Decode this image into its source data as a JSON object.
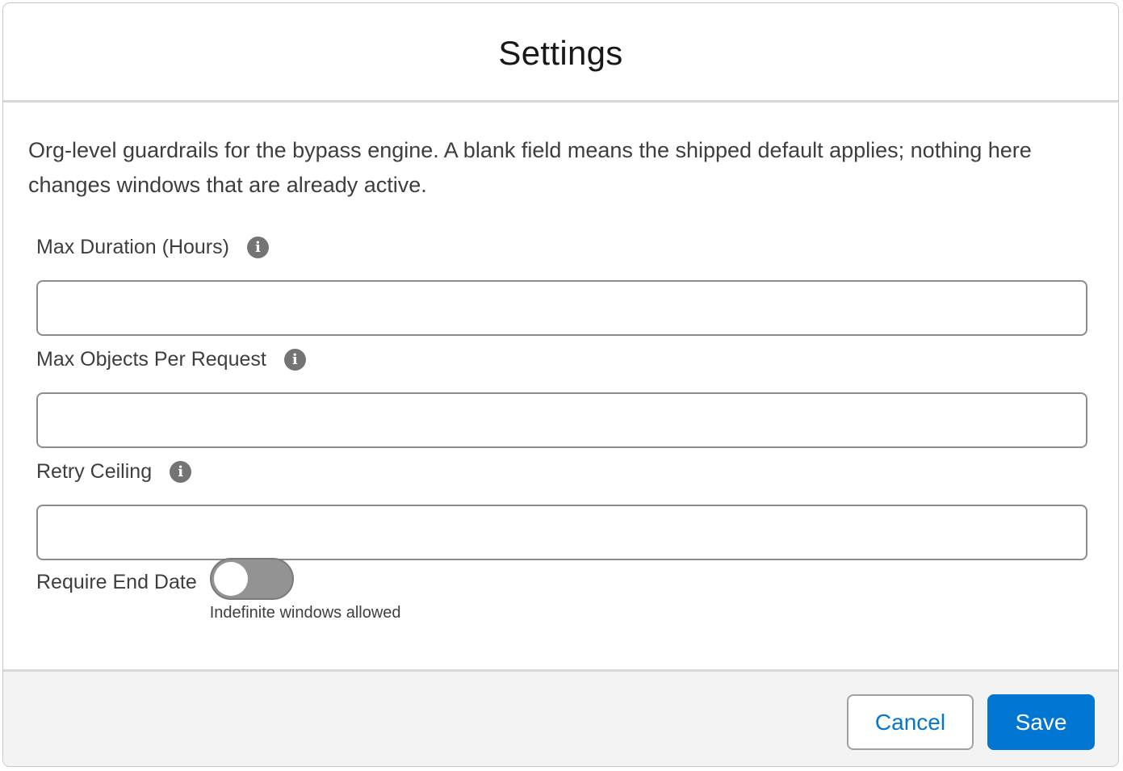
{
  "modal": {
    "title": "Settings",
    "description": "Org-level guardrails for the bypass engine. A blank field means the shipped default applies; nothing here changes windows that are already active."
  },
  "fields": [
    {
      "label": "Max Duration (Hours)",
      "value": "",
      "info_icon": "info-icon"
    },
    {
      "label": "Max Objects Per Request",
      "value": "",
      "info_icon": "info-icon"
    },
    {
      "label": "Retry Ceiling",
      "value": "",
      "info_icon": "info-icon"
    }
  ],
  "toggle": {
    "label": "Require End Date",
    "state": "off",
    "caption": "Indefinite windows allowed"
  },
  "footer": {
    "cancel_label": "Cancel",
    "save_label": "Save"
  },
  "colors": {
    "brand": "#0176d3",
    "footer_bg": "#f3f3f3",
    "toggle_off": "#939393"
  }
}
